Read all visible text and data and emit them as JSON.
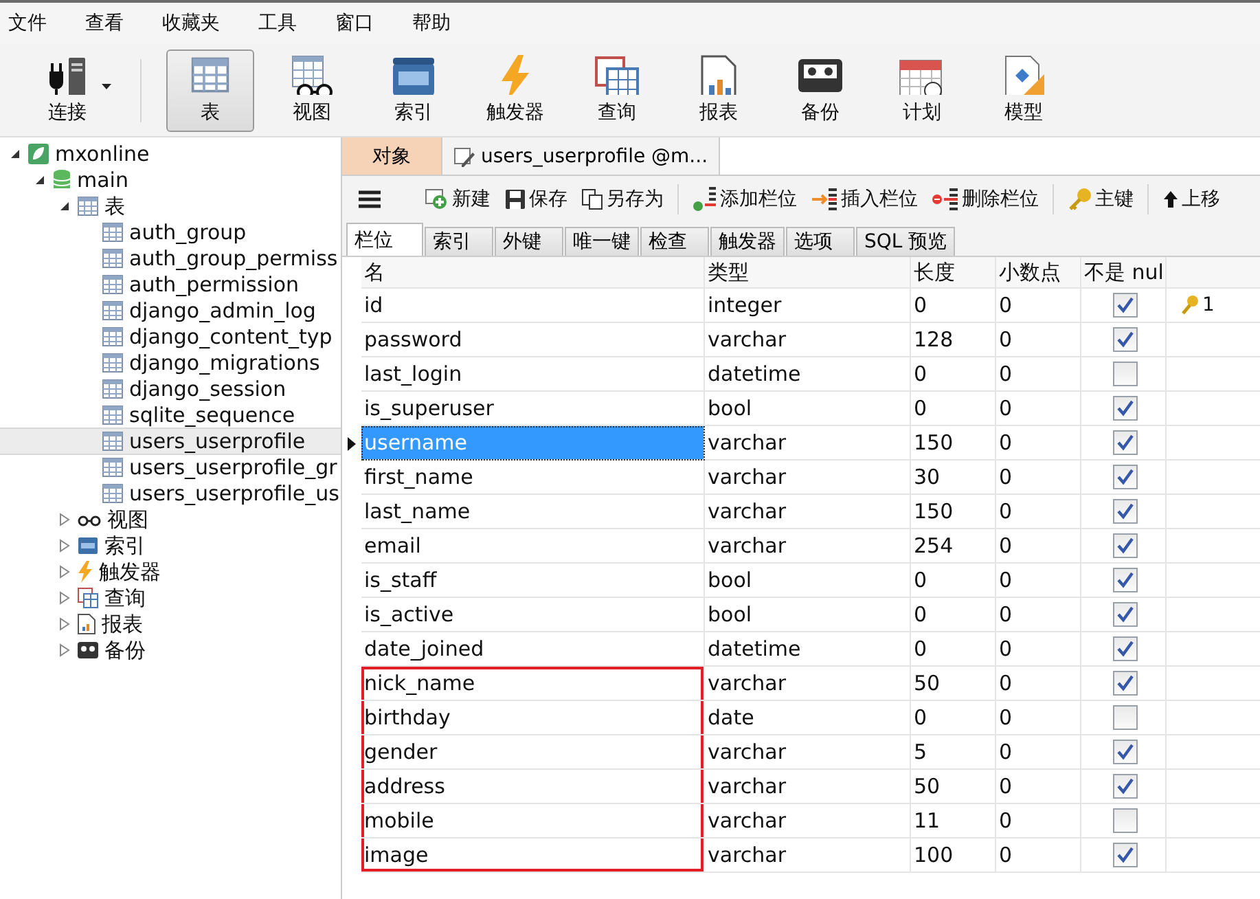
{
  "menu": [
    "文件",
    "查看",
    "收藏夹",
    "工具",
    "窗口",
    "帮助"
  ],
  "toolbar": [
    {
      "label": "连接",
      "selected": false,
      "dropdown": true
    },
    {
      "label": "表",
      "selected": true,
      "dropdown": false
    },
    {
      "label": "视图",
      "selected": false,
      "dropdown": false
    },
    {
      "label": "索引",
      "selected": false,
      "dropdown": false
    },
    {
      "label": "触发器",
      "selected": false,
      "dropdown": false
    },
    {
      "label": "查询",
      "selected": false,
      "dropdown": false
    },
    {
      "label": "报表",
      "selected": false,
      "dropdown": false
    },
    {
      "label": "备份",
      "selected": false,
      "dropdown": false
    },
    {
      "label": "计划",
      "selected": false,
      "dropdown": false
    },
    {
      "label": "模型",
      "selected": false,
      "dropdown": false
    }
  ],
  "tree": [
    {
      "label": "mxonline",
      "kind": "connection",
      "expanded": true,
      "selected": false,
      "children": [
        {
          "label": "main",
          "kind": "database",
          "expanded": true,
          "selected": false,
          "children": [
            {
              "label": "表",
              "kind": "tables",
              "expanded": true,
              "selected": false,
              "children": [
                {
                  "label": "auth_group",
                  "kind": "table",
                  "selected": false
                },
                {
                  "label": "auth_group_permiss",
                  "kind": "table",
                  "selected": false
                },
                {
                  "label": "auth_permission",
                  "kind": "table",
                  "selected": false
                },
                {
                  "label": "django_admin_log",
                  "kind": "table",
                  "selected": false
                },
                {
                  "label": "django_content_typ",
                  "kind": "table",
                  "selected": false
                },
                {
                  "label": "django_migrations",
                  "kind": "table",
                  "selected": false
                },
                {
                  "label": "django_session",
                  "kind": "table",
                  "selected": false
                },
                {
                  "label": "sqlite_sequence",
                  "kind": "table",
                  "selected": false
                },
                {
                  "label": "users_userprofile",
                  "kind": "table",
                  "selected": true
                },
                {
                  "label": "users_userprofile_gr",
                  "kind": "table",
                  "selected": false
                },
                {
                  "label": "users_userprofile_us",
                  "kind": "table",
                  "selected": false
                }
              ]
            },
            {
              "label": "视图",
              "kind": "views",
              "expanded": false,
              "selected": false
            },
            {
              "label": "索引",
              "kind": "indexes",
              "expanded": false,
              "selected": false
            },
            {
              "label": "触发器",
              "kind": "triggers",
              "expanded": false,
              "selected": false
            },
            {
              "label": "查询",
              "kind": "queries",
              "expanded": false,
              "selected": false
            },
            {
              "label": "报表",
              "kind": "reports",
              "expanded": false,
              "selected": false
            },
            {
              "label": "备份",
              "kind": "backups",
              "expanded": false,
              "selected": false
            }
          ]
        }
      ]
    }
  ],
  "doc_tabs": [
    {
      "label": "对象",
      "selected": false,
      "kind": "plain"
    },
    {
      "label": "users_userprofile @m...",
      "selected": true,
      "kind": "design"
    }
  ],
  "editor_toolbar": [
    {
      "label": "新建",
      "kind": "new"
    },
    {
      "label": "保存",
      "kind": "save"
    },
    {
      "label": "另存为",
      "kind": "saveas"
    },
    {
      "label": "添加栏位",
      "kind": "add"
    },
    {
      "label": "插入栏位",
      "kind": "insert"
    },
    {
      "label": "删除栏位",
      "kind": "delete"
    },
    {
      "label": "主键",
      "kind": "key"
    },
    {
      "label": "上移",
      "kind": "up"
    }
  ],
  "sub_tabs": [
    {
      "label": "栏位",
      "selected": true
    },
    {
      "label": "索引",
      "selected": false
    },
    {
      "label": "外键",
      "selected": false
    },
    {
      "label": "唯一键",
      "selected": false
    },
    {
      "label": "检查",
      "selected": false
    },
    {
      "label": "触发器",
      "selected": false
    },
    {
      "label": "选项",
      "selected": false
    },
    {
      "label": "SQL 预览",
      "selected": false
    }
  ],
  "table": {
    "columns": [
      "名",
      "类型",
      "长度",
      "小数点",
      "不是 nul"
    ],
    "rows": [
      {
        "name": "id",
        "type": "integer",
        "length": "0",
        "decimals": "0",
        "not_null": true,
        "key": "1",
        "selected": false,
        "marked": false
      },
      {
        "name": "password",
        "type": "varchar",
        "length": "128",
        "decimals": "0",
        "not_null": true,
        "selected": false,
        "marked": false
      },
      {
        "name": "last_login",
        "type": "datetime",
        "length": "0",
        "decimals": "0",
        "not_null": false,
        "selected": false,
        "marked": false
      },
      {
        "name": "is_superuser",
        "type": "bool",
        "length": "0",
        "decimals": "0",
        "not_null": true,
        "selected": false,
        "marked": false
      },
      {
        "name": "username",
        "type": "varchar",
        "length": "150",
        "decimals": "0",
        "not_null": true,
        "selected": true,
        "marked": false
      },
      {
        "name": "first_name",
        "type": "varchar",
        "length": "30",
        "decimals": "0",
        "not_null": true,
        "selected": false,
        "marked": false
      },
      {
        "name": "last_name",
        "type": "varchar",
        "length": "150",
        "decimals": "0",
        "not_null": true,
        "selected": false,
        "marked": false
      },
      {
        "name": "email",
        "type": "varchar",
        "length": "254",
        "decimals": "0",
        "not_null": true,
        "selected": false,
        "marked": false
      },
      {
        "name": "is_staff",
        "type": "bool",
        "length": "0",
        "decimals": "0",
        "not_null": true,
        "selected": false,
        "marked": false
      },
      {
        "name": "is_active",
        "type": "bool",
        "length": "0",
        "decimals": "0",
        "not_null": true,
        "selected": false,
        "marked": false
      },
      {
        "name": "date_joined",
        "type": "datetime",
        "length": "0",
        "decimals": "0",
        "not_null": true,
        "selected": false,
        "marked": false
      },
      {
        "name": "nick_name",
        "type": "varchar",
        "length": "50",
        "decimals": "0",
        "not_null": true,
        "selected": false,
        "marked": true
      },
      {
        "name": "birthday",
        "type": "date",
        "length": "0",
        "decimals": "0",
        "not_null": false,
        "selected": false,
        "marked": true
      },
      {
        "name": "gender",
        "type": "varchar",
        "length": "5",
        "decimals": "0",
        "not_null": true,
        "selected": false,
        "marked": true
      },
      {
        "name": "address",
        "type": "varchar",
        "length": "50",
        "decimals": "0",
        "not_null": true,
        "selected": false,
        "marked": true
      },
      {
        "name": "mobile",
        "type": "varchar",
        "length": "11",
        "decimals": "0",
        "not_null": false,
        "selected": false,
        "marked": true
      },
      {
        "name": "image",
        "type": "varchar",
        "length": "100",
        "decimals": "0",
        "not_null": true,
        "selected": false,
        "marked": true
      }
    ]
  }
}
